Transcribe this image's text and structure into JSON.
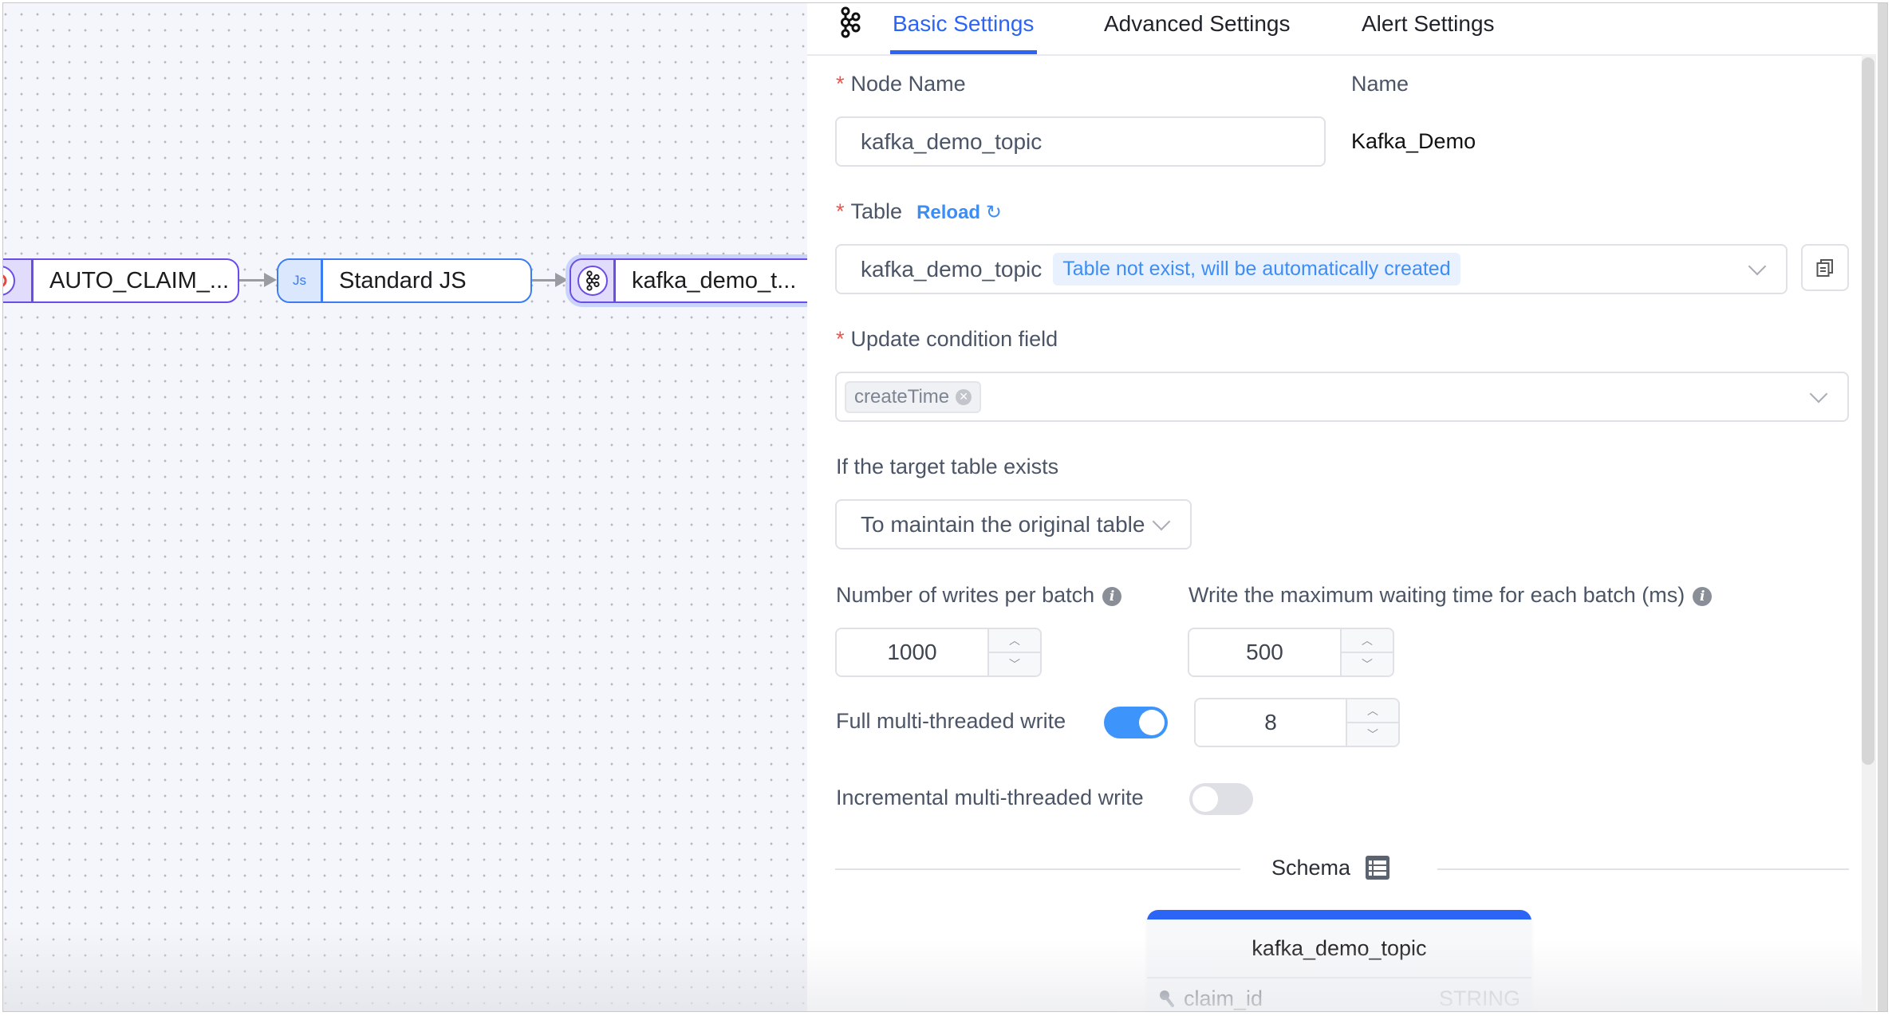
{
  "canvas": {
    "nodes": [
      {
        "label": "AUTO_CLAIM_...",
        "icon": "source-db-icon"
      },
      {
        "label": "Standard JS",
        "icon": "js-icon",
        "icon_text": "Js"
      },
      {
        "label": "kafka_demo_t...",
        "icon": "kafka-icon",
        "selected": true
      }
    ]
  },
  "panel": {
    "tabs": [
      {
        "label": "Basic Settings",
        "active": true
      },
      {
        "label": "Advanced Settings",
        "active": false
      },
      {
        "label": "Alert Settings",
        "active": false
      }
    ],
    "node_name": {
      "label": "Node Name",
      "required_mark": "*",
      "value": "kafka_demo_topic"
    },
    "name": {
      "label": "Name",
      "value": "Kafka_Demo"
    },
    "table": {
      "label": "Table",
      "required_mark": "*",
      "reload_label": "Reload",
      "value": "kafka_demo_topic",
      "hint": "Table not exist, will be automatically created"
    },
    "update_condition": {
      "label": "Update condition field",
      "required_mark": "*",
      "tags": [
        "createTime"
      ]
    },
    "target_exists": {
      "label": "If the target table exists",
      "value": "To maintain the original table structure"
    },
    "writes_per_batch": {
      "label": "Number of writes per batch",
      "value": "1000"
    },
    "max_wait": {
      "label": "Write the maximum waiting time for each batch (ms)",
      "value": "500"
    },
    "full_mt": {
      "label": "Full multi-threaded write",
      "enabled": true,
      "threads": "8"
    },
    "incr_mt": {
      "label": "Incremental multi-threaded write",
      "enabled": false
    },
    "schema": {
      "title": "Schema",
      "table_name": "kafka_demo_topic",
      "fields": [
        {
          "name": "claim_id",
          "type": "STRING",
          "is_key": true
        }
      ]
    },
    "colors": {
      "accent": "#2c65f5",
      "link": "#3d8df5",
      "required": "#f0524a",
      "toggle_on": "#3d94fa"
    }
  }
}
